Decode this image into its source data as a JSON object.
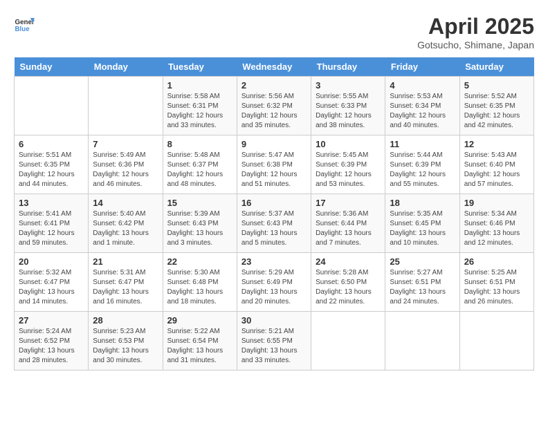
{
  "header": {
    "logo_line1": "General",
    "logo_line2": "Blue",
    "title": "April 2025",
    "subtitle": "Gotsucho, Shimane, Japan"
  },
  "weekdays": [
    "Sunday",
    "Monday",
    "Tuesday",
    "Wednesday",
    "Thursday",
    "Friday",
    "Saturday"
  ],
  "weeks": [
    [
      {
        "day": "",
        "info": ""
      },
      {
        "day": "",
        "info": ""
      },
      {
        "day": "1",
        "info": "Sunrise: 5:58 AM\nSunset: 6:31 PM\nDaylight: 12 hours and 33 minutes."
      },
      {
        "day": "2",
        "info": "Sunrise: 5:56 AM\nSunset: 6:32 PM\nDaylight: 12 hours and 35 minutes."
      },
      {
        "day": "3",
        "info": "Sunrise: 5:55 AM\nSunset: 6:33 PM\nDaylight: 12 hours and 38 minutes."
      },
      {
        "day": "4",
        "info": "Sunrise: 5:53 AM\nSunset: 6:34 PM\nDaylight: 12 hours and 40 minutes."
      },
      {
        "day": "5",
        "info": "Sunrise: 5:52 AM\nSunset: 6:35 PM\nDaylight: 12 hours and 42 minutes."
      }
    ],
    [
      {
        "day": "6",
        "info": "Sunrise: 5:51 AM\nSunset: 6:35 PM\nDaylight: 12 hours and 44 minutes."
      },
      {
        "day": "7",
        "info": "Sunrise: 5:49 AM\nSunset: 6:36 PM\nDaylight: 12 hours and 46 minutes."
      },
      {
        "day": "8",
        "info": "Sunrise: 5:48 AM\nSunset: 6:37 PM\nDaylight: 12 hours and 48 minutes."
      },
      {
        "day": "9",
        "info": "Sunrise: 5:47 AM\nSunset: 6:38 PM\nDaylight: 12 hours and 51 minutes."
      },
      {
        "day": "10",
        "info": "Sunrise: 5:45 AM\nSunset: 6:39 PM\nDaylight: 12 hours and 53 minutes."
      },
      {
        "day": "11",
        "info": "Sunrise: 5:44 AM\nSunset: 6:39 PM\nDaylight: 12 hours and 55 minutes."
      },
      {
        "day": "12",
        "info": "Sunrise: 5:43 AM\nSunset: 6:40 PM\nDaylight: 12 hours and 57 minutes."
      }
    ],
    [
      {
        "day": "13",
        "info": "Sunrise: 5:41 AM\nSunset: 6:41 PM\nDaylight: 12 hours and 59 minutes."
      },
      {
        "day": "14",
        "info": "Sunrise: 5:40 AM\nSunset: 6:42 PM\nDaylight: 13 hours and 1 minute."
      },
      {
        "day": "15",
        "info": "Sunrise: 5:39 AM\nSunset: 6:43 PM\nDaylight: 13 hours and 3 minutes."
      },
      {
        "day": "16",
        "info": "Sunrise: 5:37 AM\nSunset: 6:43 PM\nDaylight: 13 hours and 5 minutes."
      },
      {
        "day": "17",
        "info": "Sunrise: 5:36 AM\nSunset: 6:44 PM\nDaylight: 13 hours and 7 minutes."
      },
      {
        "day": "18",
        "info": "Sunrise: 5:35 AM\nSunset: 6:45 PM\nDaylight: 13 hours and 10 minutes."
      },
      {
        "day": "19",
        "info": "Sunrise: 5:34 AM\nSunset: 6:46 PM\nDaylight: 13 hours and 12 minutes."
      }
    ],
    [
      {
        "day": "20",
        "info": "Sunrise: 5:32 AM\nSunset: 6:47 PM\nDaylight: 13 hours and 14 minutes."
      },
      {
        "day": "21",
        "info": "Sunrise: 5:31 AM\nSunset: 6:47 PM\nDaylight: 13 hours and 16 minutes."
      },
      {
        "day": "22",
        "info": "Sunrise: 5:30 AM\nSunset: 6:48 PM\nDaylight: 13 hours and 18 minutes."
      },
      {
        "day": "23",
        "info": "Sunrise: 5:29 AM\nSunset: 6:49 PM\nDaylight: 13 hours and 20 minutes."
      },
      {
        "day": "24",
        "info": "Sunrise: 5:28 AM\nSunset: 6:50 PM\nDaylight: 13 hours and 22 minutes."
      },
      {
        "day": "25",
        "info": "Sunrise: 5:27 AM\nSunset: 6:51 PM\nDaylight: 13 hours and 24 minutes."
      },
      {
        "day": "26",
        "info": "Sunrise: 5:25 AM\nSunset: 6:51 PM\nDaylight: 13 hours and 26 minutes."
      }
    ],
    [
      {
        "day": "27",
        "info": "Sunrise: 5:24 AM\nSunset: 6:52 PM\nDaylight: 13 hours and 28 minutes."
      },
      {
        "day": "28",
        "info": "Sunrise: 5:23 AM\nSunset: 6:53 PM\nDaylight: 13 hours and 30 minutes."
      },
      {
        "day": "29",
        "info": "Sunrise: 5:22 AM\nSunset: 6:54 PM\nDaylight: 13 hours and 31 minutes."
      },
      {
        "day": "30",
        "info": "Sunrise: 5:21 AM\nSunset: 6:55 PM\nDaylight: 13 hours and 33 minutes."
      },
      {
        "day": "",
        "info": ""
      },
      {
        "day": "",
        "info": ""
      },
      {
        "day": "",
        "info": ""
      }
    ]
  ]
}
